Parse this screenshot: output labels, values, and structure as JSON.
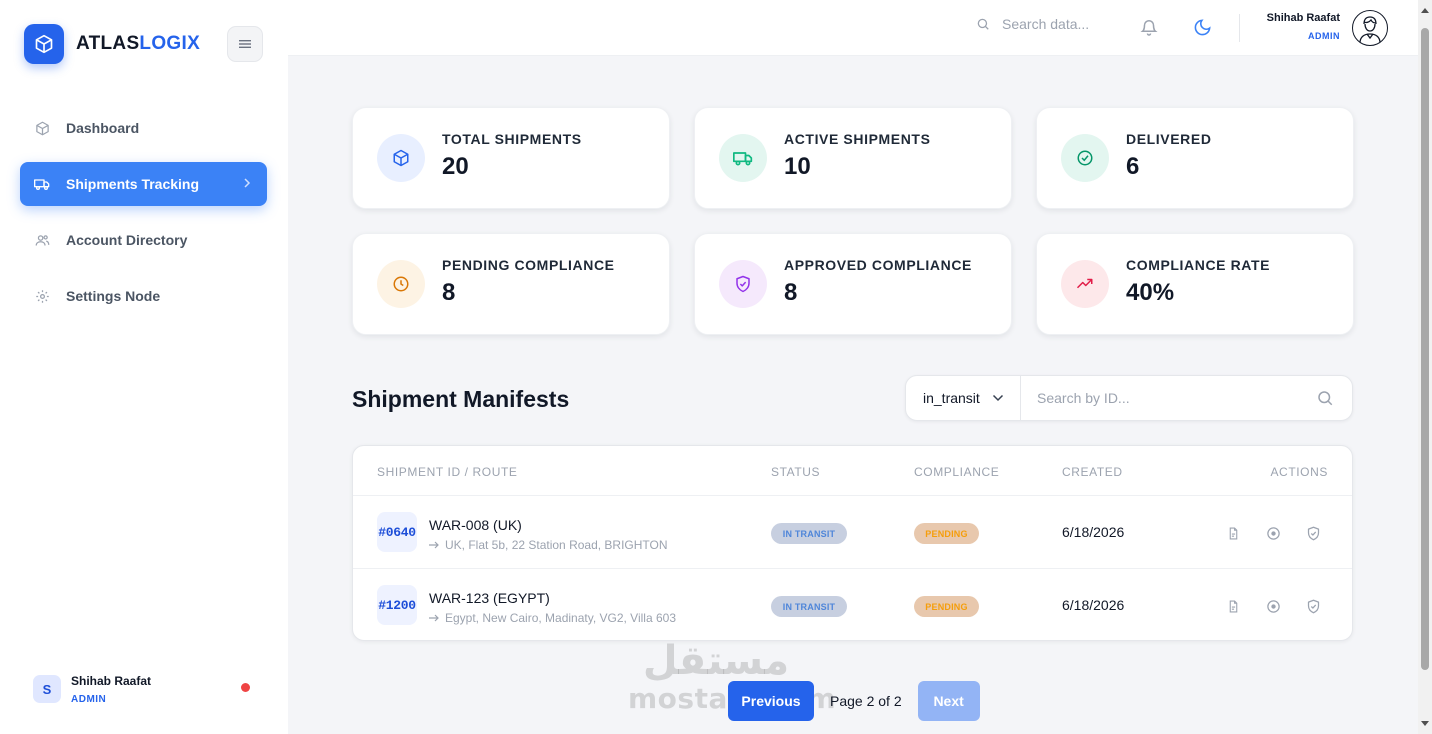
{
  "brand": {
    "name_part1": "ATLAS",
    "name_part2": "LOGIX"
  },
  "sidebar": {
    "items": [
      {
        "label": "Dashboard",
        "icon": "box-icon"
      },
      {
        "label": "Shipments Tracking",
        "icon": "truck-icon",
        "active": true
      },
      {
        "label": "Account Directory",
        "icon": "users-icon"
      },
      {
        "label": "Settings Node",
        "icon": "gear-icon"
      }
    ],
    "user": {
      "initial": "S",
      "name": "Shihab Raafat",
      "role": "ADMIN",
      "status_color": "#ef4444"
    }
  },
  "header": {
    "search_placeholder": "Search data...",
    "user": {
      "name": "Shihab Raafat",
      "role": "ADMIN"
    }
  },
  "stats": [
    {
      "label": "TOTAL SHIPMENTS",
      "value": "20",
      "icon": "box-icon",
      "bg": "#e8efff",
      "color": "#2563eb"
    },
    {
      "label": "ACTIVE SHIPMENTS",
      "value": "10",
      "icon": "truck-icon",
      "bg": "#e3f6f0",
      "color": "#10b981"
    },
    {
      "label": "DELIVERED",
      "value": "6",
      "icon": "check-circle-icon",
      "bg": "#e3f6f0",
      "color": "#059669"
    },
    {
      "label": "PENDING COMPLIANCE",
      "value": "8",
      "icon": "clock-icon",
      "bg": "#fdf3e4",
      "color": "#d97706"
    },
    {
      "label": "APPROVED COMPLIANCE",
      "value": "8",
      "icon": "shield-check-icon",
      "bg": "#f5e9fc",
      "color": "#9333ea"
    },
    {
      "label": "COMPLIANCE RATE",
      "value": "40%",
      "icon": "trending-up-icon",
      "bg": "#fde8ea",
      "color": "#e11d48"
    }
  ],
  "manifests": {
    "title": "Shipment Manifests",
    "filter": {
      "selected": "in_transit",
      "search_placeholder": "Search by ID..."
    },
    "columns": [
      "SHIPMENT ID / ROUTE",
      "STATUS",
      "COMPLIANCE",
      "CREATED",
      "ACTIONS"
    ],
    "rows": [
      {
        "id": "#0640",
        "title": "WAR-008 (UK)",
        "route": "UK, Flat 5b, 22 Station Road, BRIGHTON",
        "status": "IN TRANSIT",
        "compliance": "PENDING",
        "created": "6/18/2026"
      },
      {
        "id": "#1200",
        "title": "WAR-123 (EGYPT)",
        "route": "Egypt, New Cairo, Madinaty, VG2, Villa 603",
        "status": "IN TRANSIT",
        "compliance": "PENDING",
        "created": "6/18/2026"
      }
    ]
  },
  "pagination": {
    "prev_label": "Previous",
    "info": "Page 2 of 2",
    "next_label": "Next"
  },
  "watermark": {
    "arabic": "مستقل",
    "latin": "mostaql.com"
  }
}
